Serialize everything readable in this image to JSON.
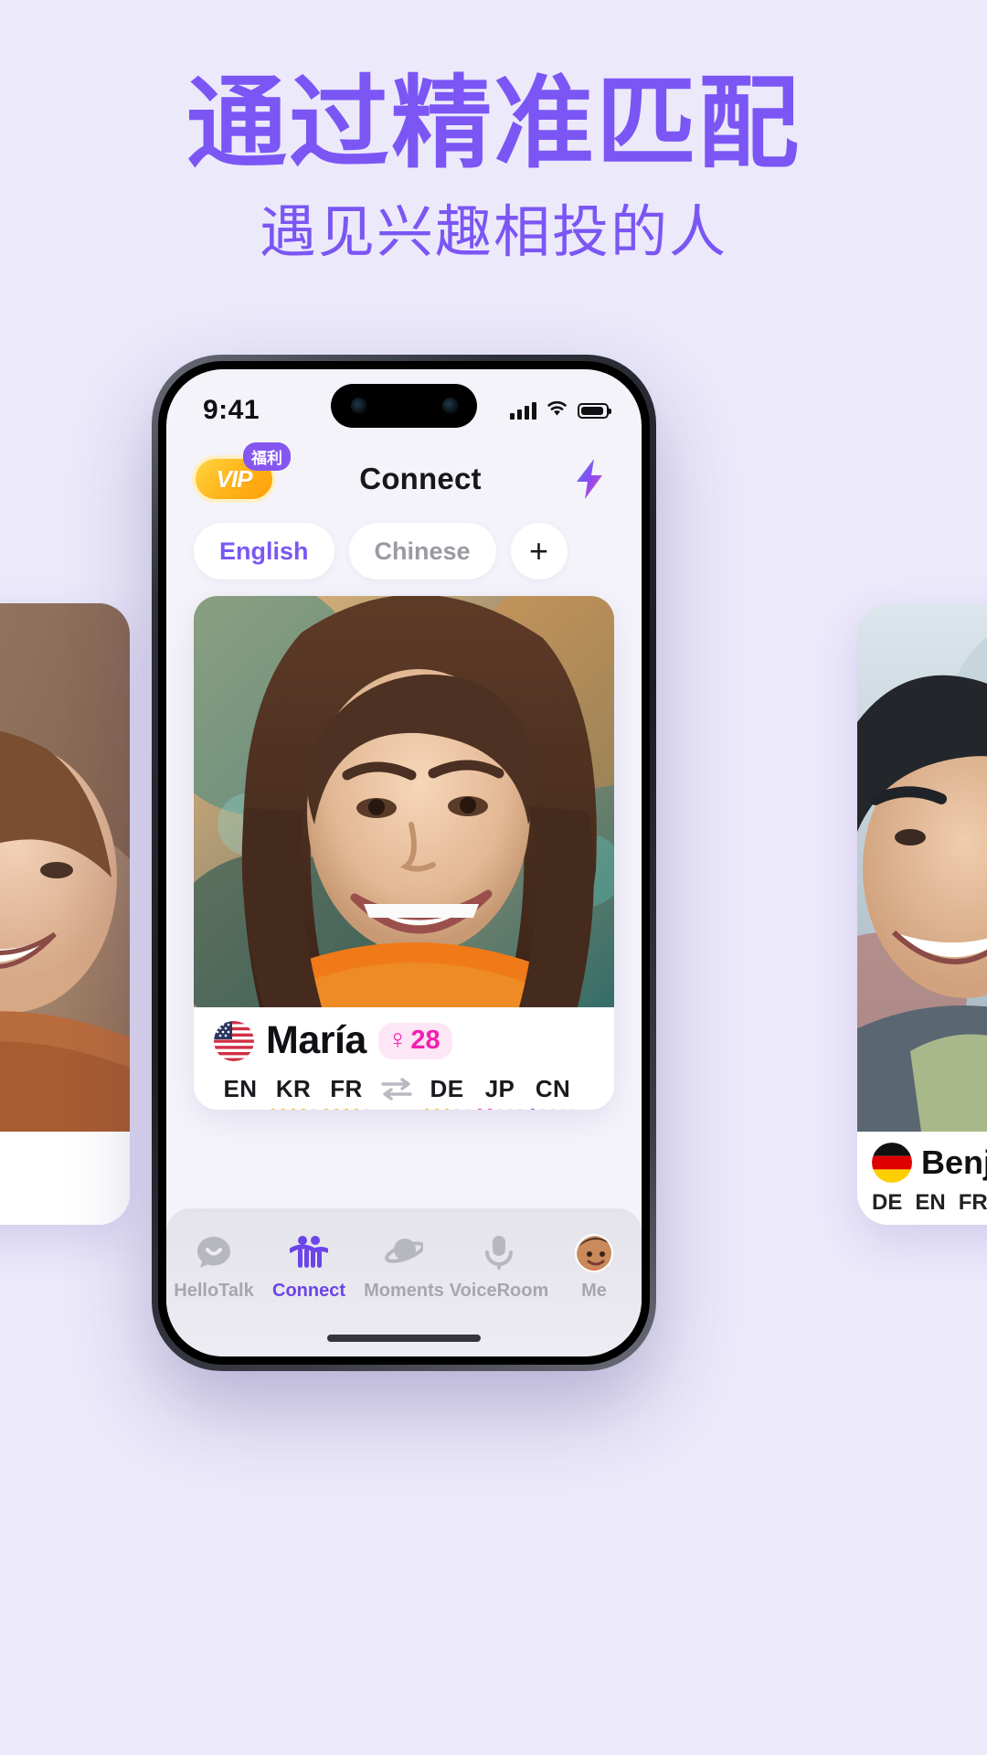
{
  "promo": {
    "headline": "通过精准匹配",
    "subheadline": "遇见兴趣相投的人",
    "accent_color": "#7B56F4",
    "background_color": "#ECE9FB"
  },
  "phone": {
    "status_bar": {
      "time": "9:41",
      "signal_icon": "cellular-bars-icon",
      "wifi_icon": "wifi-icon",
      "battery_icon": "battery-icon"
    },
    "header": {
      "vip_label": "VIP",
      "vip_badge": "福利",
      "title": "Connect",
      "action_icon": "lightning-bolt-icon"
    },
    "filters": {
      "chips": [
        {
          "label": "English",
          "active": true
        },
        {
          "label": "Chinese",
          "active": false
        }
      ],
      "add_label": "+"
    },
    "profile_card": {
      "flag": "us-flag-icon",
      "name": "María",
      "gender_symbol": "♀",
      "age": "28",
      "languages": [
        {
          "code": "EN",
          "native": true,
          "level": 5,
          "color": "#9ACD32"
        },
        {
          "code": "KR",
          "native": false,
          "level": 4,
          "color": "#F5B301"
        },
        {
          "code": "FR",
          "native": false,
          "level": 4,
          "color": "#F5B301"
        },
        {
          "code": "DE",
          "native": false,
          "level": 3,
          "color": "#F5B301"
        },
        {
          "code": "JP",
          "native": false,
          "level": 2,
          "color": "#F51EB0"
        },
        {
          "code": "CN",
          "native": false,
          "level": 1,
          "color": "#6B45E8"
        }
      ],
      "swap_icon": "exchange-arrows-icon"
    },
    "tabbar": {
      "items": [
        {
          "label": "HelloTalk",
          "icon": "chat-bubble-icon",
          "active": false
        },
        {
          "label": "Connect",
          "icon": "two-people-icon",
          "active": true
        },
        {
          "label": "Moments",
          "icon": "planet-icon",
          "active": false
        },
        {
          "label": "VoiceRoom",
          "icon": "microphone-icon",
          "active": false
        },
        {
          "label": "Me",
          "icon": "avatar-icon",
          "active": false
        }
      ],
      "active_color": "#6B45E8",
      "inactive_color": "#A6A6B0"
    }
  },
  "peek_cards": {
    "left": {
      "flag": "unknown-flag-icon",
      "name": "",
      "languages": []
    },
    "right": {
      "flag": "de-flag-icon",
      "name": "Benja",
      "languages": [
        "DE",
        "EN",
        "FR"
      ]
    }
  }
}
